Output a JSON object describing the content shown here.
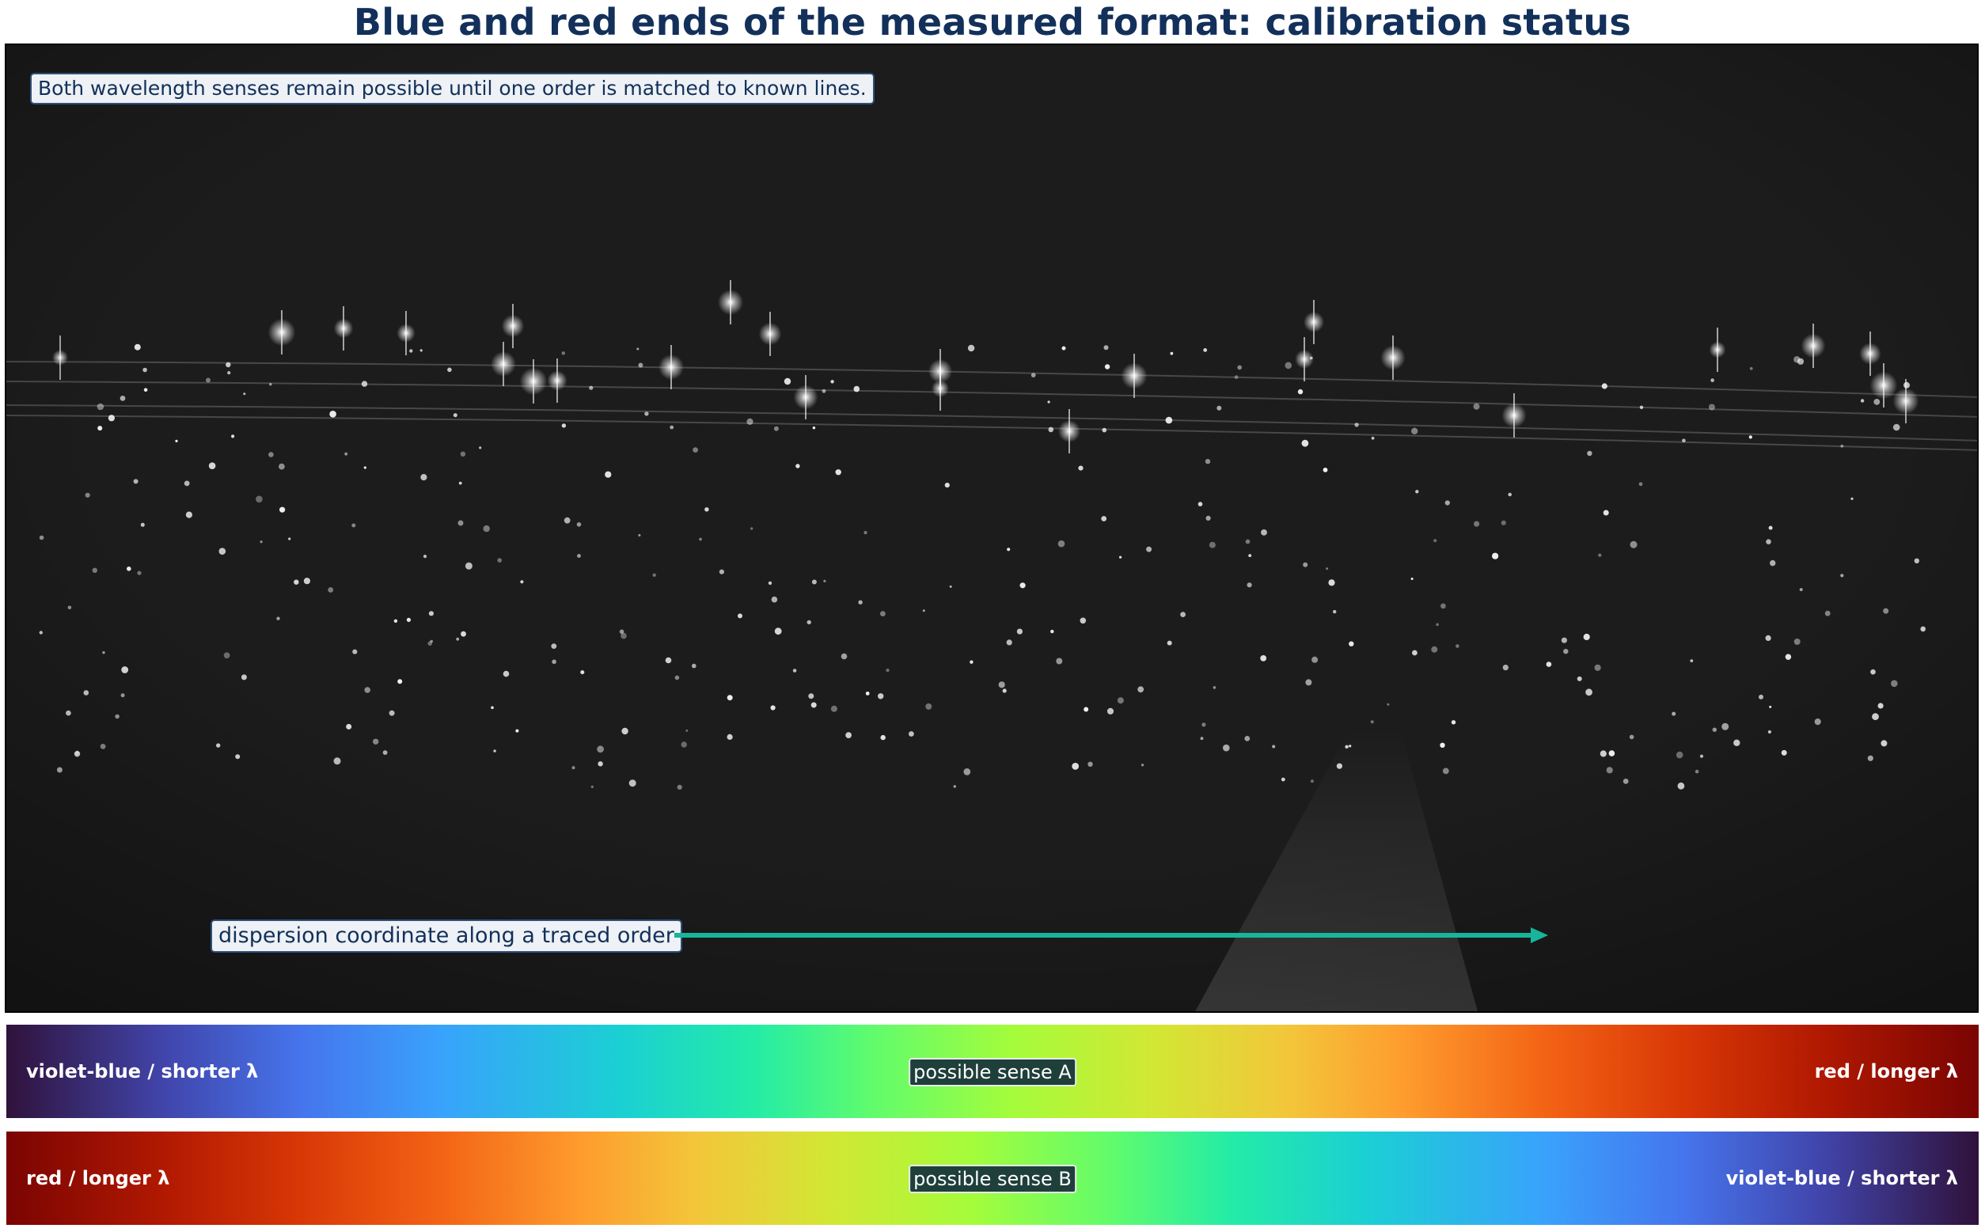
{
  "title": "Blue and red ends of the measured format: calibration status",
  "note": "Both wavelength senses remain possible until one order is matched to known lines.",
  "axis_label": "dispersion coordinate along a traced order",
  "bands": [
    {
      "center_label": "possible sense A",
      "left_label": "violet-blue / shorter λ",
      "right_label": "red / longer λ"
    },
    {
      "center_label": "possible sense B",
      "left_label": "red / longer λ",
      "right_label": "violet-blue / shorter λ"
    }
  ],
  "colors": {
    "title": "#12305a",
    "arrow": "#18b59a",
    "spectrum_background": "#1b1b1b"
  }
}
